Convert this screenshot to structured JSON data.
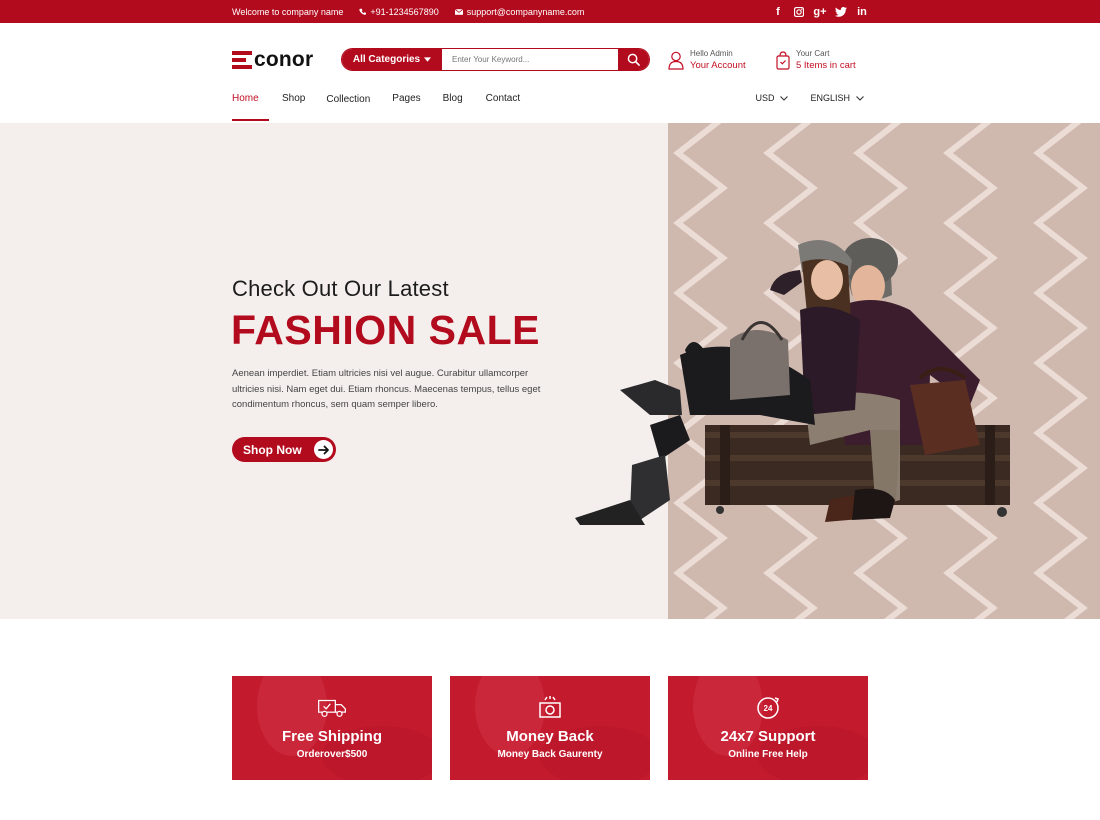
{
  "topbar": {
    "welcome": "Welcome to company name",
    "phone": "+91-1234567890",
    "email": "support@companyname.com",
    "social_icons": [
      "facebook-icon",
      "instagram-icon",
      "google-plus-icon",
      "twitter-icon",
      "linkedin-icon"
    ],
    "social_glyphs": [
      "f",
      "◙",
      "g+",
      "t",
      "in"
    ]
  },
  "header": {
    "logo_text": "conor",
    "search": {
      "category_label": "All Categories",
      "placeholder": "Enter Your Keyword..."
    },
    "account": {
      "greeting": "Hello Admin",
      "label": "Your Account"
    },
    "cart": {
      "title": "Your Cart",
      "count_label": "5 Items in cart"
    }
  },
  "nav": {
    "items": [
      "Home",
      "Shop",
      "Collection",
      "Pages",
      "Blog",
      "Contact"
    ],
    "active": "Home",
    "currency": "USD",
    "language": "ENGLISH"
  },
  "hero": {
    "subtitle": "Check Out Our Latest",
    "title": "FASHION SALE",
    "text": "Aenean imperdiet. Etiam ultricies nisi vel augue. Curabitur ullamcorper ultricies nisi. Nam eget dui. Etiam rhoncus. Maecenas tempus, tellus eget condimentum rhoncus, sem quam semper libero.",
    "button": "Shop Now"
  },
  "features": [
    {
      "icon": "truck-icon",
      "title": "Free Shipping",
      "subtitle": "Orderover$500"
    },
    {
      "icon": "money-icon",
      "title": "Money Back",
      "subtitle": "Money Back Gaurenty"
    },
    {
      "icon": "support-24-icon",
      "title": "24x7 Support",
      "subtitle": "Online Free Help"
    }
  ],
  "colors": {
    "brand": "#b30b1e",
    "hero_left_bg": "#f4eeec",
    "hero_right_bg": "#cfb8ae",
    "feature_bg": "#c41a2e"
  }
}
